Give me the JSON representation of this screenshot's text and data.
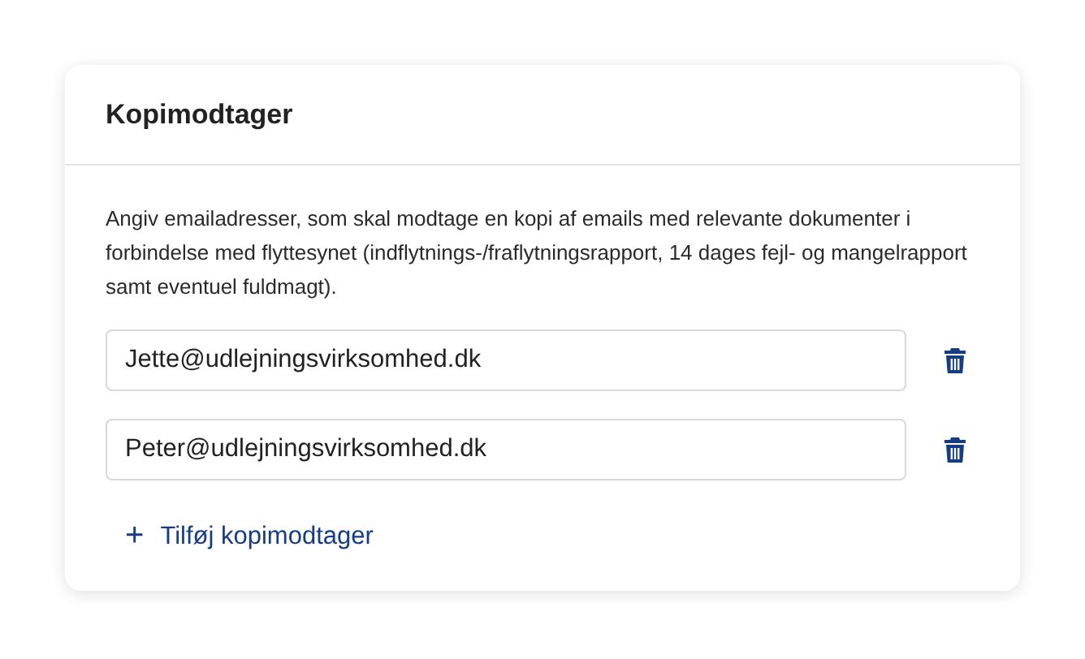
{
  "card": {
    "title": "Kopimodtager",
    "description": "Angiv emailadresser, som skal modtage en kopi af emails med relevante dokumenter i forbindelse med flyttesynet (indflytnings-/fraflytningsrapport, 14 dages fejl- og mangelrapport samt eventuel fuldmagt).",
    "recipients": [
      {
        "value": "Jette@udlejningsvirksomhed.dk"
      },
      {
        "value": "Peter@udlejningsvirksomhed.dk"
      }
    ],
    "add_button": {
      "icon": "+",
      "label": "Tilføj kopimodtager"
    }
  }
}
